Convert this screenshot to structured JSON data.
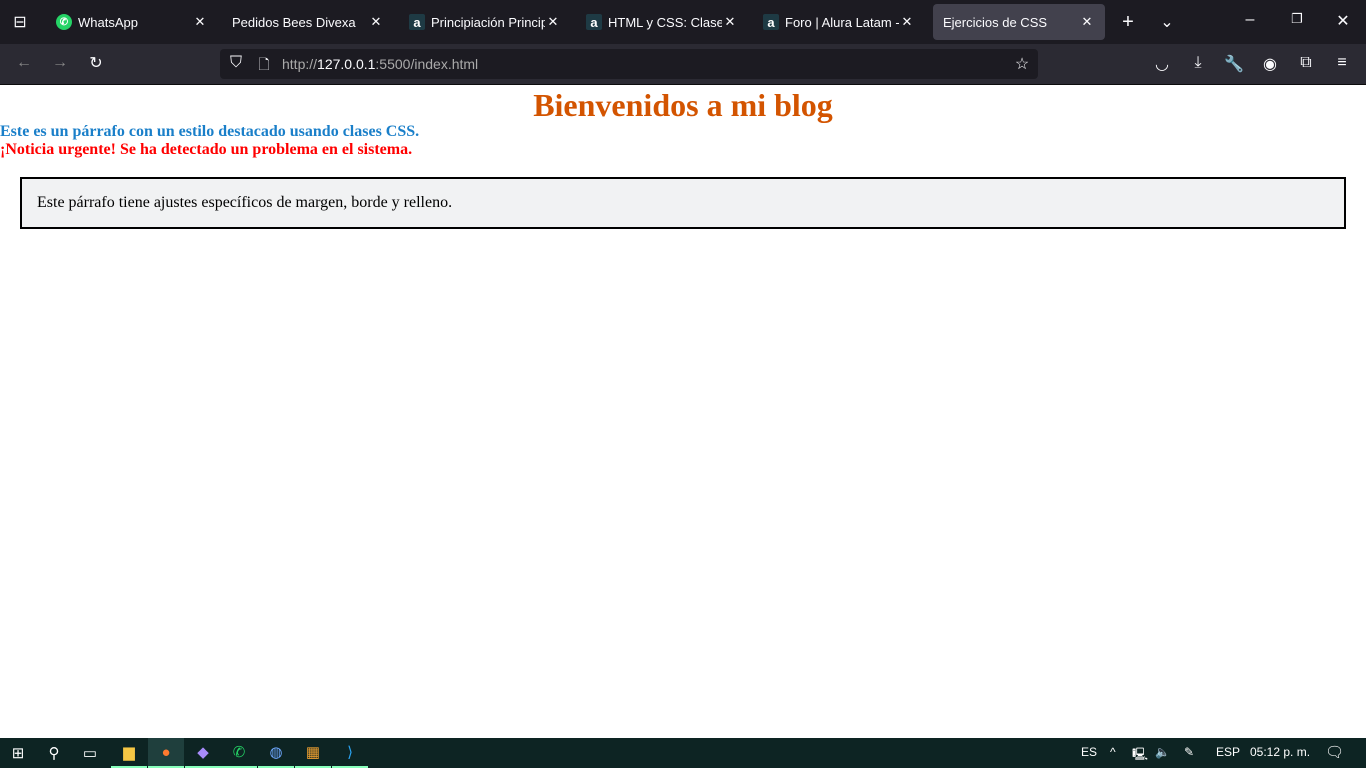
{
  "browser": {
    "tabs": [
      {
        "title": "WhatsApp",
        "icon": "whatsapp-icon"
      },
      {
        "title": "Pedidos Bees Divexa",
        "icon": ""
      },
      {
        "title": "Principiación Principiante",
        "icon": "alura-icon"
      },
      {
        "title": "HTML y CSS: Clases, Posicionamiento",
        "icon": "alura-icon"
      },
      {
        "title": "Foro | Alura Latam - Cursos",
        "icon": "alura-icon"
      },
      {
        "title": "Ejercicios de CSS",
        "icon": "",
        "active": true
      }
    ],
    "url_prefix": "http://",
    "url_host": "127.0.0.1",
    "url_rest": ":5500/index.html"
  },
  "page": {
    "heading": "Bienvenidos a mi blog",
    "highlight_paragraph": "Este es un párrafo con un estilo destacado usando clases CSS.",
    "urgent_paragraph": "¡Noticia urgente! Se ha detectado un problema en el sistema.",
    "boxed_paragraph": "Este párrafo tiene ajustes específicos de margen, borde y relleno.",
    "colors": {
      "heading": "#d35400",
      "highlight": "#1a7fc9",
      "urgent": "#ff0000"
    }
  },
  "taskbar": {
    "lang": "ES",
    "keyboard": "ESP",
    "time": "05:12 p. m."
  }
}
